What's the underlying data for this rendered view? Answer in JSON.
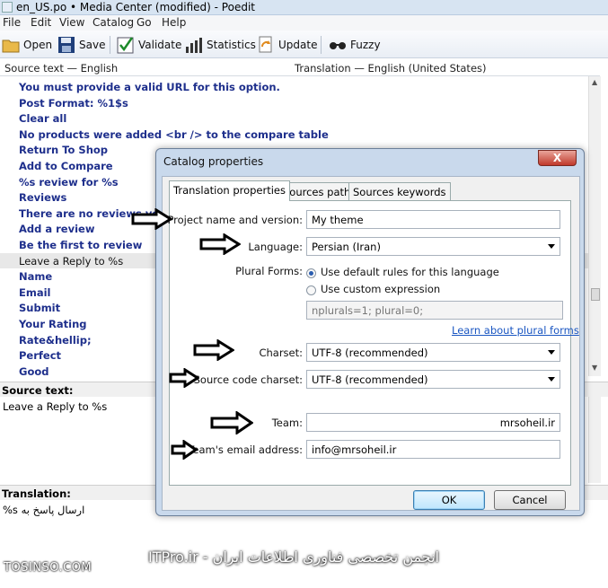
{
  "window": {
    "title": "en_US.po • Media Center (modified) - Poedit"
  },
  "menu": [
    "File",
    "Edit",
    "View",
    "Catalog",
    "Go",
    "Help"
  ],
  "toolbar": {
    "open": "Open",
    "save": "Save",
    "validate": "Validate",
    "statistics": "Statistics",
    "update": "Update",
    "fuzzy": "Fuzzy"
  },
  "list": {
    "col_source": "Source text — English",
    "col_translation": "Translation — English (United States)",
    "rows": [
      "You must provide a valid URL for this option.",
      "Post Format: %1$s",
      "Clear all",
      "No products were added <br /> to the compare table",
      "Return To Shop",
      "Add to Compare",
      "%s review for %s",
      "Reviews",
      "There are no reviews yet",
      "Add a review",
      "Be the first to review",
      "Leave a Reply to %s",
      "Name",
      "Email",
      "Submit",
      "Your Rating",
      "Rate&hellip;",
      "Perfect",
      "Good"
    ],
    "selected_index": 11
  },
  "source_pane": {
    "heading": "Source text:",
    "text": "Leave a Reply to %s"
  },
  "translation_pane": {
    "heading": "Translation:",
    "text": "%s ارسال پاسخ به"
  },
  "dialog": {
    "title": "Catalog properties",
    "close": "X",
    "tabs": [
      "Translation properties",
      "Sources paths",
      "Sources keywords"
    ],
    "labels": {
      "project": "Project name and version:",
      "language": "Language:",
      "plural": "Plural Forms:",
      "charset": "Charset:",
      "source_charset": "Source code charset:",
      "team": "Team:",
      "team_email": "Team's email address:"
    },
    "values": {
      "project": "My theme",
      "language": "Persian (Iran)",
      "plural_default": "Use default rules for this language",
      "plural_custom": "Use custom expression",
      "plural_expr": "nplurals=1; plural=0;",
      "plural_link": "Learn about plural forms",
      "charset": "UTF-8 (recommended)",
      "source_charset": "UTF-8 (recommended)",
      "team": "mrsoheil.ir",
      "team_email": "info@mrsoheil.ir"
    },
    "ok": "OK",
    "cancel": "Cancel"
  },
  "watermarks": {
    "left": "TOSINSO.COM",
    "right": "ITPro.ir - انجمن تخصصی فناوری اطلاعات ایران"
  }
}
